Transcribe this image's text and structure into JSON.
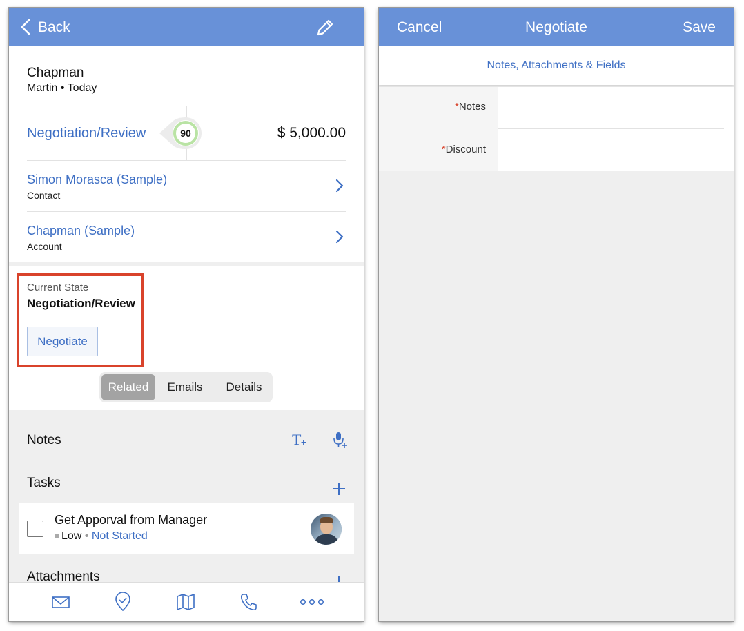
{
  "left": {
    "nav": {
      "back_label": "Back",
      "edit_icon": "pencil-icon"
    },
    "record": {
      "name": "Chapman",
      "owner": "Martin",
      "date": "Today",
      "stage": "Negotiation/Review",
      "probability": "90",
      "amount": "$ 5,000.00"
    },
    "contact": {
      "name": "Simon Morasca (Sample)",
      "type": "Contact"
    },
    "account": {
      "name": "Chapman (Sample)",
      "type": "Account"
    },
    "current_state": {
      "label": "Current State",
      "value": "Negotiation/Review",
      "button": "Negotiate"
    },
    "tabs": [
      "Related",
      "Emails",
      "Details"
    ],
    "sections": {
      "notes": "Notes",
      "tasks": "Tasks",
      "attachments": "Attachments"
    },
    "task": {
      "title": "Get Apporval from Manager",
      "priority": "Low",
      "status": "Not Started"
    },
    "bottom_icons": [
      "mail-icon",
      "checkin-icon",
      "map-icon",
      "phone-icon",
      "more-icon"
    ],
    "highlight_color": "#d9432b"
  },
  "right": {
    "nav": {
      "cancel": "Cancel",
      "title": "Negotiate",
      "save": "Save"
    },
    "subheader": "Notes, Attachments & Fields",
    "fields": [
      {
        "label": "Notes",
        "required": "*"
      },
      {
        "label": "Discount",
        "required": "*"
      }
    ]
  },
  "colors": {
    "nav_bg": "#6891d8",
    "link": "#3e6fc4",
    "required": "#d9432b"
  }
}
